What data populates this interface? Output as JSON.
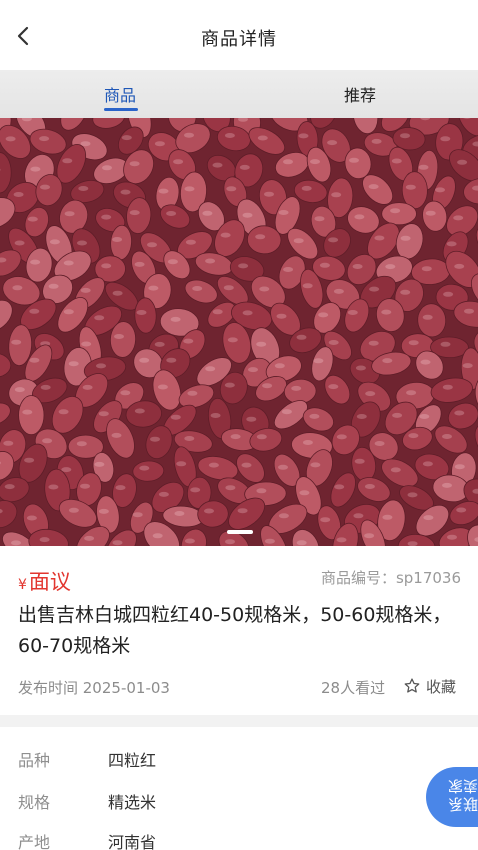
{
  "header": {
    "title": "商品详情",
    "back_icon": "chevron-left-icon"
  },
  "tabs": [
    {
      "label": "商品",
      "active": true
    },
    {
      "label": "推荐",
      "active": false
    }
  ],
  "gallery": {
    "image": "peanut kernels photo",
    "slides_indicator": "1"
  },
  "product": {
    "currency_symbol": "¥",
    "price": "面议",
    "code": "商品编号：sp17036",
    "title": "出售吉林白城四粒红40-50规格米，50-60规格米，60-70规格米",
    "publish_time": "发布时间 2025-01-03",
    "views": "28人看过",
    "favorite_label": "收藏"
  },
  "specs": [
    {
      "key": "品种",
      "value": "四粒红"
    },
    {
      "key": "规格",
      "value": "精选米"
    },
    {
      "key": "产地",
      "value": "河南省"
    }
  ],
  "floating_button": {
    "label": "联系卖家"
  },
  "colors": {
    "accent": "#2a63c9",
    "price": "#e2362f",
    "float": "#4a86e8"
  }
}
